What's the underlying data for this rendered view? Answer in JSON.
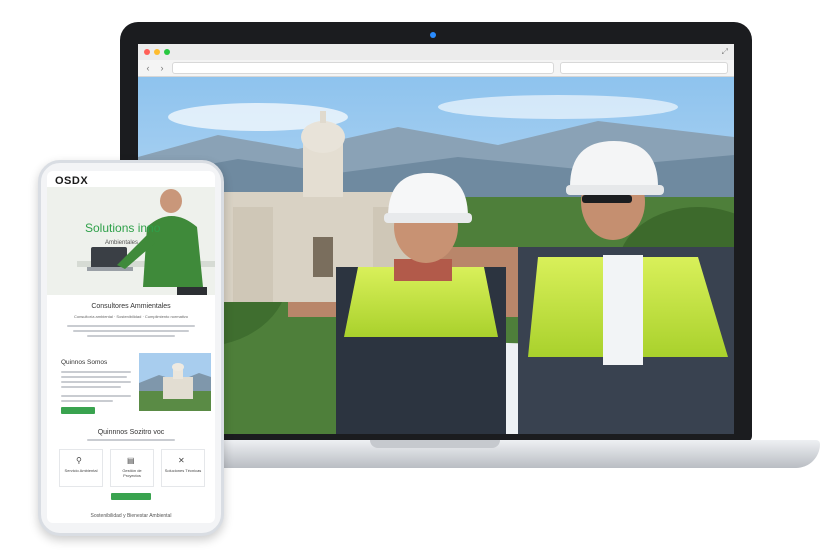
{
  "phone": {
    "logo": "OSDX",
    "hero_title": "Solutions inno",
    "hero_subtitle": "Ambientales",
    "section1_title": "Consultores Ammientales",
    "section1_subtitle": "Consultoría ambiental · Sostenibilidad · Cumplimiento normativo",
    "about_title": "Quinnos Somos",
    "services_title": "Quinnnos Sozitro voc",
    "services": [
      {
        "icon": "person-icon",
        "label": "Servicio Ambiental"
      },
      {
        "icon": "document-icon",
        "label": "Gestión de Proyectos"
      },
      {
        "icon": "tools-icon",
        "label": "Soluciones Técnicas"
      }
    ],
    "footer": "Sostenibilidad y Bienestar Ambiental"
  },
  "colors": {
    "accent_green": "#39a34f",
    "hero_title_green": "#2fa14a",
    "laptop_bezel": "#1b1c1f",
    "camera_blue": "#2a8cff"
  }
}
